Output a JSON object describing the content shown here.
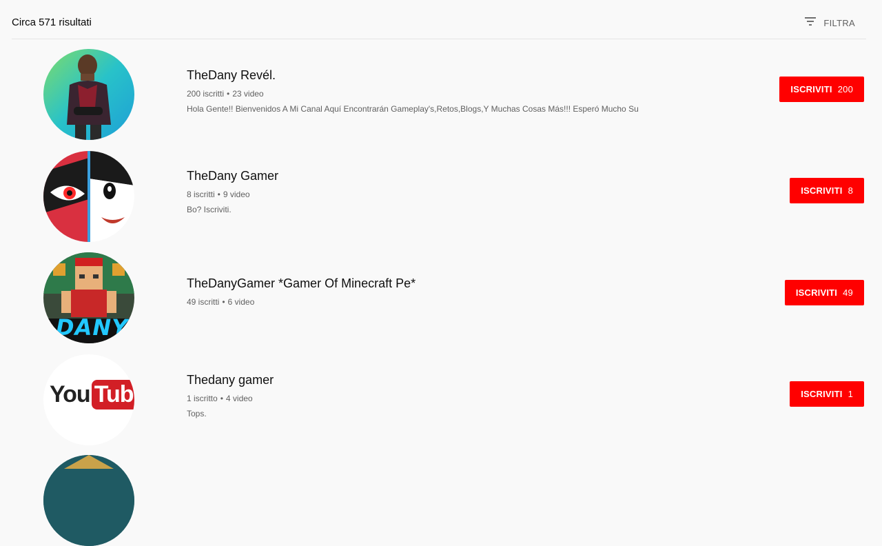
{
  "header": {
    "result_count": "Circa 571 risultati",
    "filter_label": "FILTRA",
    "filter_icon": "filter-icon"
  },
  "channels": [
    {
      "name": "TheDany Revél.",
      "subscribers": "200 iscritti",
      "videos": "23 video",
      "description": "Hola Gente!! Bienvenidos A Mi Canal Aquí Encontrarán Gameplay's,Retos,Blogs,Y Muchas Cosas Más!!! Esperó Mucho Su",
      "subscribe_label": "ISCRIVITI",
      "subscribe_count": "200"
    },
    {
      "name": "TheDany Gamer",
      "subscribers": "8 iscritti",
      "videos": "9 video",
      "description": "Bo? Iscriviti.",
      "subscribe_label": "ISCRIVITI",
      "subscribe_count": "8"
    },
    {
      "name": "TheDanyGamer *Gamer Of Minecraft Pe*",
      "subscribers": "49 iscritti",
      "videos": "6 video",
      "description": "",
      "subscribe_label": "ISCRIVITI",
      "subscribe_count": "49",
      "avatar_text": "DANY"
    },
    {
      "name": "Thedany gamer",
      "subscribers": "1 iscritto",
      "videos": "4 video",
      "description": "Tops.",
      "subscribe_label": "ISCRIVITI",
      "subscribe_count": "1",
      "avatar_text_1": "You",
      "avatar_text_2": "Tube"
    }
  ],
  "meta_separator": "•",
  "colors": {
    "accent": "#ff0000",
    "background": "#f9f9f9",
    "secondary_text": "#606060"
  }
}
